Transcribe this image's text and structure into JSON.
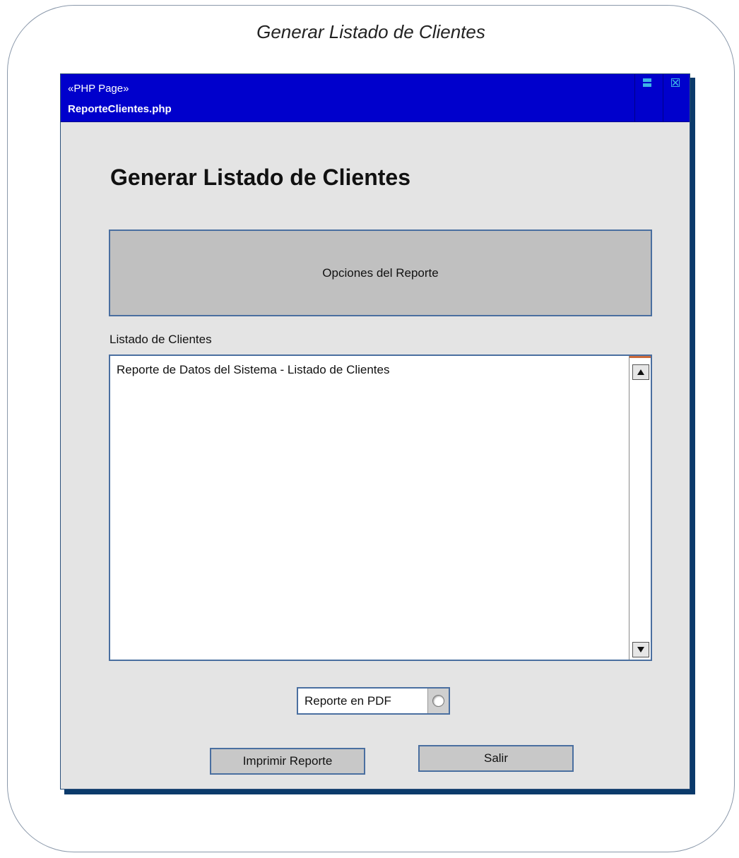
{
  "diagram": {
    "title": "Generar Listado de Clientes"
  },
  "window": {
    "stereotype": "«PHP Page»",
    "filename": "ReporteClientes.php"
  },
  "page": {
    "heading": "Generar Listado de Clientes",
    "options_panel_label": "Opciones del Reporte",
    "list_label": "Listado de Clientes",
    "list_items": [
      "Reporte de Datos del Sistema - Listado de Clientes"
    ],
    "pdf_option_label": "Reporte en PDF",
    "pdf_option_selected": false,
    "print_button": "Imprimir Reporte",
    "exit_button": "Salir"
  },
  "colors": {
    "titlebar": "#0000cc",
    "window_bg": "#e4e4e4",
    "border_accent": "#4a6fa0"
  }
}
